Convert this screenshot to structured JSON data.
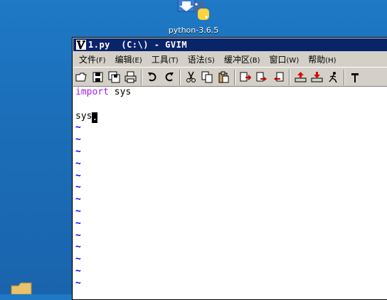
{
  "desktop": {
    "icon_label": "python-3.6.5"
  },
  "window": {
    "title": "1.py  (C:\\) - GVIM",
    "menu": [
      {
        "label": "文件",
        "accel": "(F)"
      },
      {
        "label": "编辑",
        "accel": "(E)"
      },
      {
        "label": "工具",
        "accel": "(T)"
      },
      {
        "label": "语法",
        "accel": "(S)"
      },
      {
        "label": "缓冲区",
        "accel": "(B)"
      },
      {
        "label": "窗口",
        "accel": "(W)"
      },
      {
        "label": "帮助",
        "accel": "(H)"
      }
    ],
    "toolbar_icons": [
      "open-icon",
      "save-icon",
      "save-all-icon",
      "print-icon",
      "undo-icon",
      "redo-icon",
      "cut-icon",
      "copy-icon",
      "paste-icon",
      "find-replace-icon",
      "find-next-icon",
      "find-prev-icon",
      "load-session-icon",
      "save-session-icon",
      "run-script-icon",
      "make-icon"
    ]
  },
  "editor": {
    "lines": [
      {
        "keyword": "import",
        "rest": " sys"
      },
      {
        "text": ""
      },
      {
        "text": "sys",
        "cursor": "."
      }
    ],
    "tilde": "~",
    "keyword_color": "#a020f0",
    "tilde_color": "#0000ff"
  }
}
